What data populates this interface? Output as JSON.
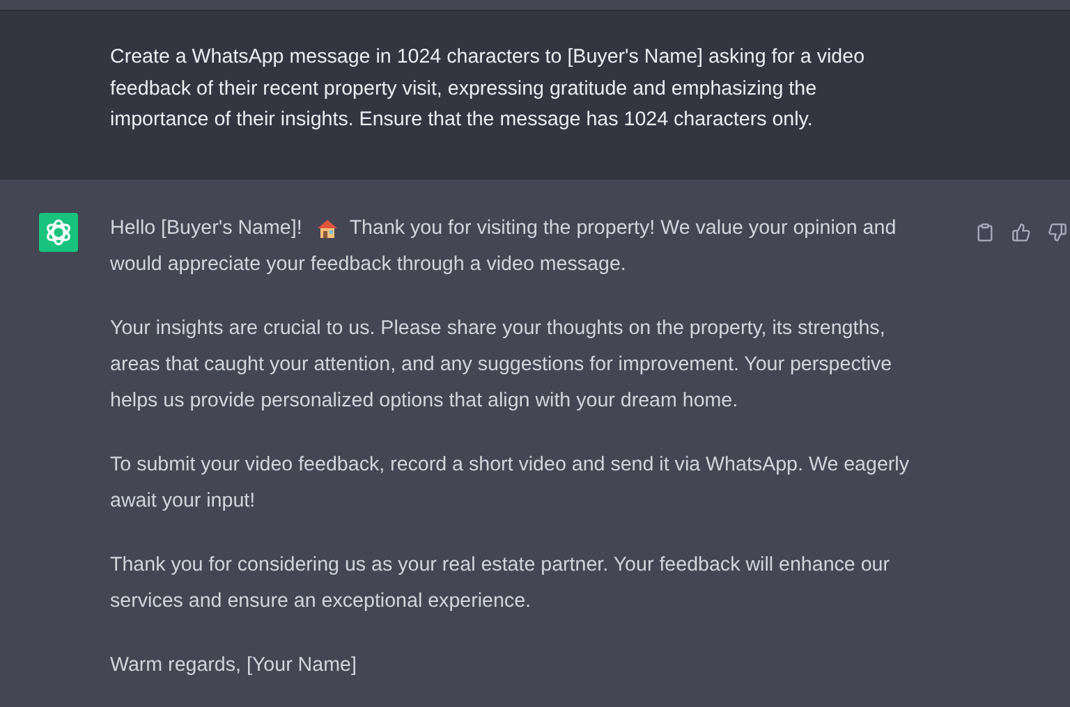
{
  "prompt": {
    "text": "Create a WhatsApp message in 1024 characters to [Buyer's Name] asking for a video feedback of their recent property visit, expressing gratitude and emphasizing the importance of their insights. Ensure that the message has 1024 characters only."
  },
  "response": {
    "greeting": "Hello [Buyer's Name]!",
    "first_line_rest": "Thank you for visiting the property! We value your opinion and",
    "second_line": "would appreciate your feedback through a video message.",
    "paragraphs": [
      "Your insights are crucial to us. Please share your thoughts on the property, its strengths, areas that caught your attention, and any suggestions for improvement. Your perspective helps us provide personalized options that align with your dream home.",
      "To submit your video feedback, record a short video and send it via WhatsApp. We eagerly await your input!",
      "Thank you for considering us as your real estate partner. Your feedback will enhance our services and ensure an exceptional experience.",
      "Warm regards, [Your Name]"
    ]
  }
}
